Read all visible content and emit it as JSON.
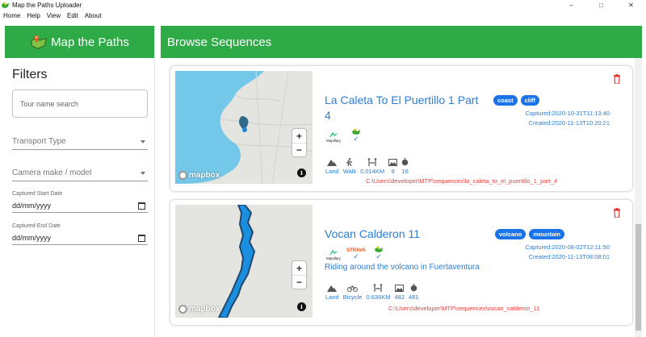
{
  "window": {
    "title": "Map the Paths Uploader",
    "controls": {
      "minimize": "–",
      "maximize": "□",
      "close": "✕"
    }
  },
  "menu": {
    "items": [
      "Home",
      "Help",
      "View",
      "Edit",
      "About"
    ]
  },
  "sidebar": {
    "brand": "Map the Paths",
    "filters_title": "Filters",
    "tour_search_placeholder": "Tour name search",
    "transport_type_label": "Transport Type",
    "camera_label": "Camera make / model",
    "start_date_label": "Captured Start Date",
    "start_date_value": "dd/mm/yyyy",
    "end_date_label": "Captured End Date",
    "end_date_value": "dd/mm/yyyy"
  },
  "main": {
    "title": "Browse Sequences",
    "sequences": [
      {
        "title_line1": "La Caleta To El Puertillo 1 Part",
        "title_line2": "4",
        "tags": [
          "coast",
          "cliff"
        ],
        "captured": "Captured:2020-10-31T11:13:40",
        "created": "Created:2020-11-13T10:20:21",
        "services": {
          "mapillary": "Mapillary"
        },
        "stats": {
          "type": "Land",
          "transport": "Walk",
          "distance": "0.014KM",
          "photos": "9",
          "duration": "16"
        },
        "path": "C:\\Users\\developer\\MTP\\sequences\\la_caleta_to_el_puertillo_1_part_4",
        "map": {
          "zoom_in": "+",
          "zoom_out": "−",
          "info": "i",
          "attribution": "mapbox"
        }
      },
      {
        "title_line1": "Vocan Calderon 11",
        "description": "Riding around the volcano in Fuertaventura",
        "tags": [
          "volcano",
          "mountain"
        ],
        "captured": "Captured:2020-08-02T12:11:50",
        "created": "Created:2020-11-13T08:08:01",
        "services": {
          "mapillary": "Mapillary",
          "strava": "STRAVA"
        },
        "stats": {
          "type": "Land",
          "transport": "Bicycle",
          "distance": "0.636KM",
          "photos": "482",
          "duration": "481"
        },
        "path": "C:\\Users\\developer\\MTP\\sequences\\vocan_calderon_11",
        "map": {
          "zoom_in": "+",
          "zoom_out": "−",
          "info": "i",
          "attribution": "mapbox"
        }
      }
    ]
  },
  "colors": {
    "brand_green": "#2eab47",
    "link_blue": "#2a7ed8",
    "tag_blue": "#1a73e8",
    "path_red": "#e8413d",
    "delete_red": "#e53935"
  }
}
